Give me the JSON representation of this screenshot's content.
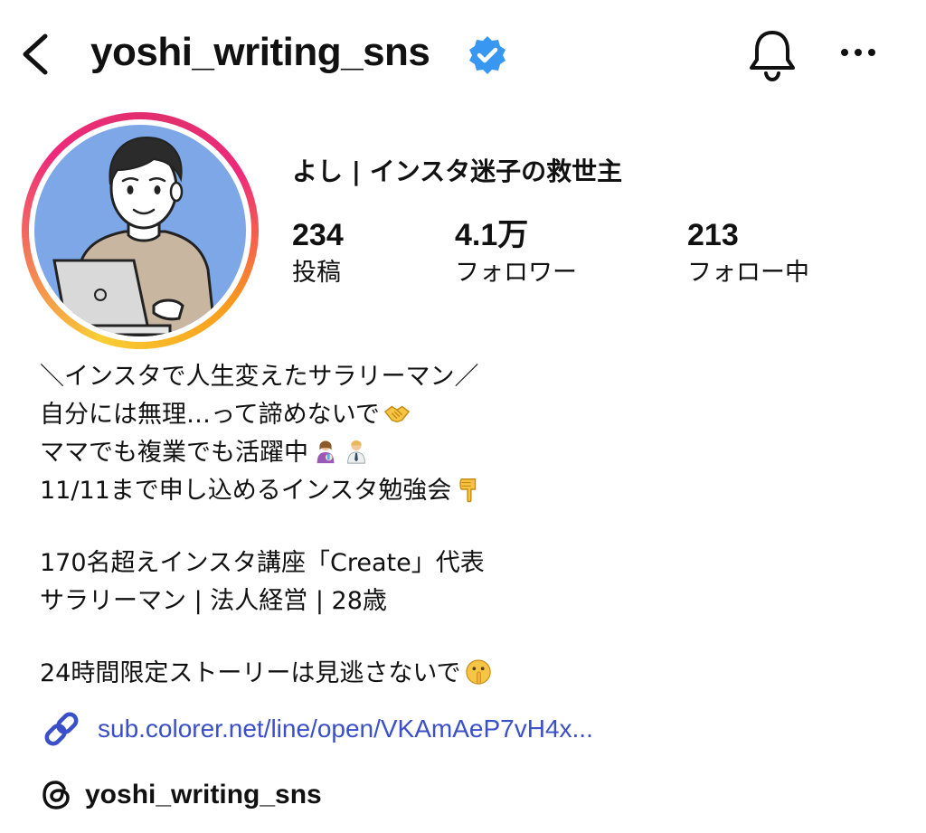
{
  "header": {
    "username": "yoshi_writing_sns",
    "verified": true,
    "icons": [
      "back-icon",
      "verified-badge-icon",
      "bell-icon",
      "more-icon"
    ]
  },
  "profile": {
    "display_name": "よし | インスタ迷子の救世主",
    "stats": [
      {
        "value": "234",
        "label": "投稿"
      },
      {
        "value": "4.1万",
        "label": "フォロワー"
      },
      {
        "value": "213",
        "label": "フォロー中"
      }
    ]
  },
  "bio": {
    "line1": "＼インスタで人生変えたサラリーマン／",
    "line2": "自分には無理…って諦めないで",
    "line3": "ママでも複業でも活躍中",
    "line4": "11/11まで申し込めるインスタ勉強会",
    "line5": "170名超えインスタ講座「Create」代表",
    "line6": "サラリーマン | 法人経営 | 28歳",
    "line7": "24時間限定ストーリーは見逃さないで",
    "emojis": [
      "handshake-emoji",
      "woman-feeding-baby-emoji",
      "office-worker-emoji",
      "pointing-down-emoji",
      "shushing-face-emoji"
    ]
  },
  "link": {
    "text": "sub.colorer.net/line/open/VKAmAeP7vH4x..."
  },
  "threads": {
    "handle": "yoshi_writing_sns"
  },
  "colors": {
    "link": "#3a4fc9",
    "verified": "#3897f0",
    "avatar_bg": "#7ea7e8"
  }
}
